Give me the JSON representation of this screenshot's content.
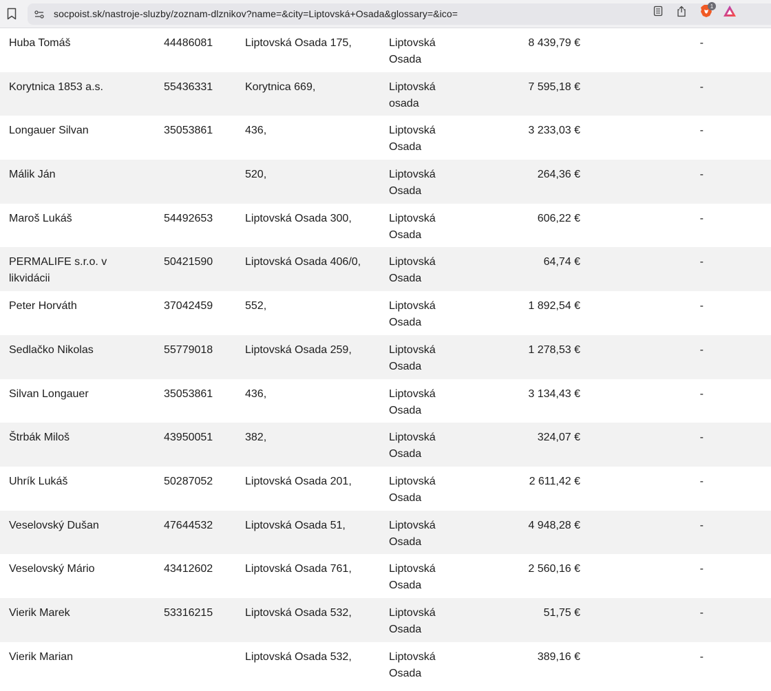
{
  "browser": {
    "url": "socpoist.sk/nastroje-sluzby/zoznam-dlznikov?name=&city=Liptovská+Osada&glossary=&ico=",
    "badge_count": "1"
  },
  "table": {
    "rows": [
      {
        "name": "Huba Tomáš",
        "ico": "44486081",
        "address": "Liptovská Osada 175,",
        "city": "Liptovská Osada",
        "amount": "8 439,79 €",
        "note": "-"
      },
      {
        "name": "Korytnica 1853 a.s.",
        "ico": "55436331",
        "address": "Korytnica 669,",
        "city": "Liptovská osada",
        "amount": "7 595,18 €",
        "note": "-"
      },
      {
        "name": "Longauer Silvan",
        "ico": "35053861",
        "address": "436,",
        "city": "Liptovská Osada",
        "amount": "3 233,03 €",
        "note": "-"
      },
      {
        "name": "Málik Ján",
        "ico": "",
        "address": "520,",
        "city": "Liptovská Osada",
        "amount": "264,36 €",
        "note": "-"
      },
      {
        "name": "Maroš Lukáš",
        "ico": "54492653",
        "address": "Liptovská Osada 300,",
        "city": "Liptovská Osada",
        "amount": "606,22 €",
        "note": "-"
      },
      {
        "name": "PERMALIFE s.r.o. v likvidácii",
        "ico": "50421590",
        "address": "Liptovská Osada 406/0,",
        "city": "Liptovská Osada",
        "amount": "64,74 €",
        "note": "-"
      },
      {
        "name": "Peter Horváth",
        "ico": "37042459",
        "address": "552,",
        "city": "Liptovská Osada",
        "amount": "1 892,54 €",
        "note": "-"
      },
      {
        "name": "Sedlačko Nikolas",
        "ico": "55779018",
        "address": "Liptovská Osada 259,",
        "city": "Liptovská Osada",
        "amount": "1 278,53 €",
        "note": "-"
      },
      {
        "name": "Silvan Longauer",
        "ico": "35053861",
        "address": "436,",
        "city": "Liptovská Osada",
        "amount": "3 134,43 €",
        "note": "-"
      },
      {
        "name": "Štrbák Miloš",
        "ico": "43950051",
        "address": "382,",
        "city": "Liptovská Osada",
        "amount": "324,07 €",
        "note": "-"
      },
      {
        "name": "Uhrík Lukáš",
        "ico": "50287052",
        "address": "Liptovská Osada 201,",
        "city": "Liptovská Osada",
        "amount": "2 611,42 €",
        "note": "-"
      },
      {
        "name": "Veselovský Dušan",
        "ico": "47644532",
        "address": "Liptovská Osada 51,",
        "city": "Liptovská Osada",
        "amount": "4 948,28 €",
        "note": "-"
      },
      {
        "name": "Veselovský Mário",
        "ico": "43412602",
        "address": "Liptovská Osada 761,",
        "city": "Liptovská Osada",
        "amount": "2 560,16 €",
        "note": "-"
      },
      {
        "name": "Vierik Marek",
        "ico": "53316215",
        "address": "Liptovská Osada 532,",
        "city": "Liptovská Osada",
        "amount": "51,75 €",
        "note": "-"
      },
      {
        "name": "Vierik Marian",
        "ico": "",
        "address": "Liptovská Osada 532,",
        "city": "Liptovská Osada",
        "amount": "389,16 €",
        "note": "-"
      }
    ]
  }
}
